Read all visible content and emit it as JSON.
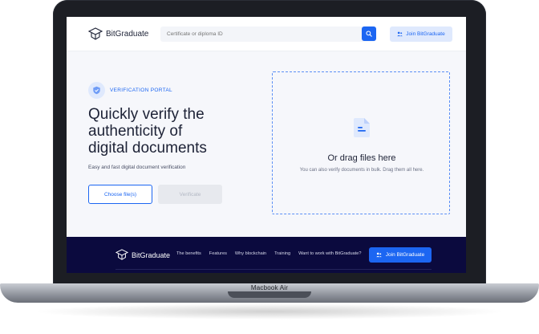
{
  "device": {
    "label": "Macbook Air"
  },
  "header": {
    "brand": "BitGraduate",
    "search_placeholder": "Certificate or diploma ID",
    "join_label": "Join BitGraduate"
  },
  "hero": {
    "badge": "VERIFICATION PORTAL",
    "headline_line1": "Quickly verify the",
    "headline_line2": "authenticity of",
    "headline_line3": "digital documents",
    "subline": "Easy and fast digital document verification",
    "choose_label": "Choose file(s)",
    "verify_label": "Verificate"
  },
  "dropzone": {
    "title": "Or drag files here",
    "subtitle": "You can also verify documents in bulk. Drag them all here."
  },
  "footer": {
    "brand": "BitGraduate",
    "links": [
      "The benefits",
      "Features",
      "Why blockchain",
      "Training",
      "Want to work with BitGraduate?"
    ],
    "join_label": "Join BitGraduate"
  },
  "colors": {
    "accent": "#1c66f2",
    "footer_bg": "#0b0a3e",
    "text_dark": "#1d2236"
  },
  "icons": [
    "graduation-cap-icon",
    "search-icon",
    "users-icon",
    "shield-check-icon",
    "document-icon"
  ]
}
